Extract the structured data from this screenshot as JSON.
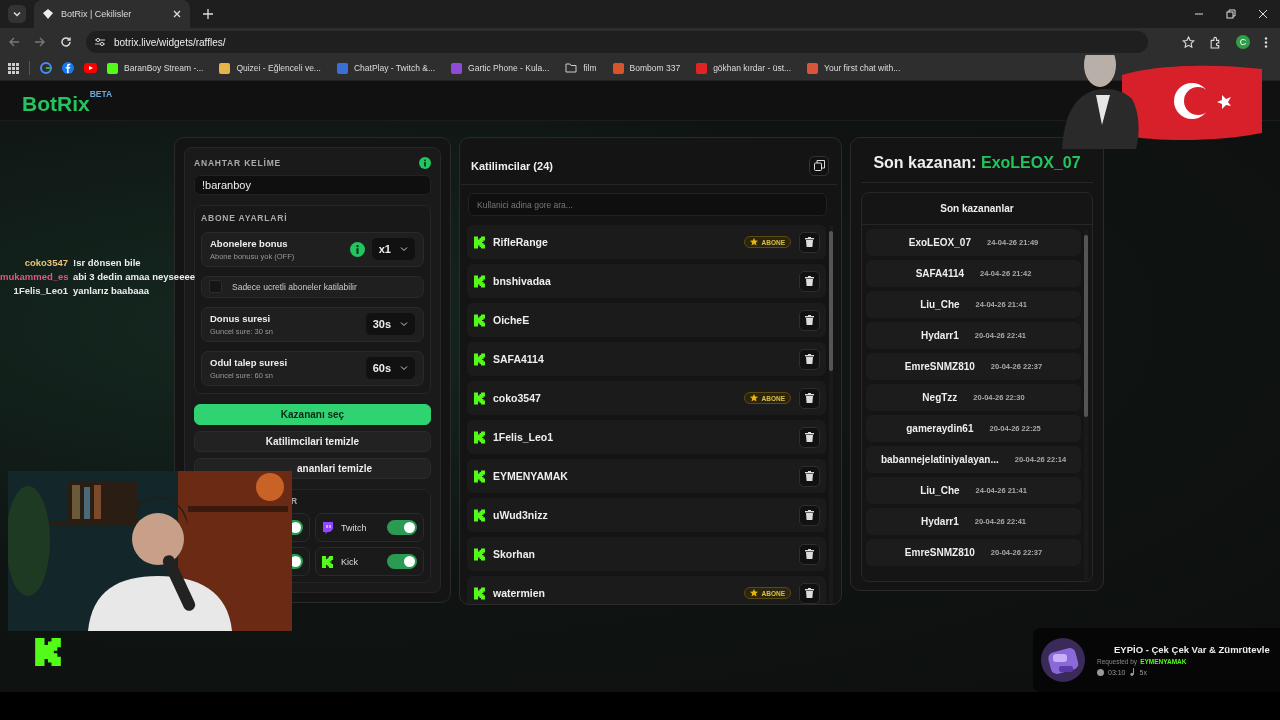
{
  "browser": {
    "tabs": [
      {
        "title": "BotRix | Cekilisler",
        "selected": true
      }
    ],
    "url": "botrix.live/widgets/raffles/",
    "profile_initial": "C",
    "bookmarks": [
      {
        "label": "BaranBoy Stream -..."
      },
      {
        "label": "Quizei - Eğlenceli ve..."
      },
      {
        "label": "ChatPlay - Twitch &..."
      },
      {
        "label": "Gartic Phone - Kula..."
      },
      {
        "label": "film"
      },
      {
        "label": "Bombom 337"
      },
      {
        "label": "gökhan kırdar - üst..."
      },
      {
        "label": "Your first chat with..."
      }
    ]
  },
  "logo": {
    "name": "BotRix",
    "badge": "BETA"
  },
  "settings": {
    "keyword_label": "ANAHTAR KELİME",
    "keyword_value": "!baranboy",
    "sub_title": "ABONE AYARLARİ",
    "bonus": {
      "title": "Abonelere bonus",
      "subtitle": "Abone bonusu yok (OFF)",
      "value": "x1"
    },
    "paid_only": {
      "label": "Sadece ucretli aboneler katilabilir",
      "checked": false
    },
    "timers": [
      {
        "title": "Donus suresi",
        "subtitle": "Guncel sure: 30 sn",
        "value": "30s"
      },
      {
        "title": "Odul talep suresi",
        "subtitle": "Guncel sure: 60 sn",
        "value": "60s"
      }
    ],
    "buttons": [
      {
        "label": "Kazananı seç",
        "kind": "primary"
      },
      {
        "label": "Katilimcilari temizle",
        "kind": "secondary"
      },
      {
        "label": "ananlari temizle",
        "kind": "secondary"
      }
    ],
    "platforms_heading": "R",
    "platforms": [
      {
        "on": true
      },
      {
        "label": "Twitch",
        "on": true
      },
      {
        "on": true
      },
      {
        "label": "Kick",
        "on": true
      }
    ]
  },
  "participants": {
    "title": "Katilimcilar (24)",
    "search_placeholder": "Kullanici adina gore ara...",
    "rows": [
      {
        "name": "RifleRange",
        "badge": "ABONE"
      },
      {
        "name": "bnshivadaa"
      },
      {
        "name": "OicheE"
      },
      {
        "name": "SAFA4114"
      },
      {
        "name": "coko3547",
        "badge": "ABONE"
      },
      {
        "name": "1Felis_Leo1"
      },
      {
        "name": "EYMENYAMAK"
      },
      {
        "name": "uWud3nizz"
      },
      {
        "name": "Skorhan"
      },
      {
        "name": "watermien",
        "badge": "ABONE"
      }
    ]
  },
  "winners": {
    "title_prefix": "Son kazanan:",
    "last_winner": "ExoLEOX_07",
    "list_title": "Son kazananlar",
    "rows": [
      {
        "name": "ExoLEOX_07",
        "time": "24-04-26 21:49"
      },
      {
        "name": "SAFA4114",
        "time": "24-04-26 21:42"
      },
      {
        "name": "Liu_Che",
        "time": "24-04-26 21:41"
      },
      {
        "name": "Hydarr1",
        "time": "20-04-26 22:41"
      },
      {
        "name": "EmreSNMZ810",
        "time": "20-04-26 22:37"
      },
      {
        "name": "NegTzz",
        "time": "20-04-26 22:30"
      },
      {
        "name": "gameraydin61",
        "time": "20-04-26 22:25"
      },
      {
        "name": "babannejelatiniyalayan...",
        "time": "20-04-26 22:14"
      },
      {
        "name": "Liu_Che",
        "time": "24-04-26 21:41"
      },
      {
        "name": "Hydarr1",
        "time": "20-04-26 22:41"
      },
      {
        "name": "EmreSNMZ810",
        "time": "20-04-26 22:37"
      }
    ]
  },
  "chat": [
    {
      "user": "coko3547",
      "color": "#e8c47c",
      "message": "!sr dönsen bile"
    },
    {
      "user": "mukammed_es",
      "color": "#e0577f",
      "message": "abi 3 dedin amaa neyseeee"
    },
    {
      "user": "1Felis_Leo1",
      "color": "#e6e6e6",
      "message": "yanlarız baabaaa"
    }
  ],
  "now_playing": {
    "title": "EYPİO - Çek Çek Var & Zümrütevle",
    "requested_label": "Requested by",
    "requester": "EYMENYAMAK",
    "duration": "03:10",
    "count": "5x"
  }
}
